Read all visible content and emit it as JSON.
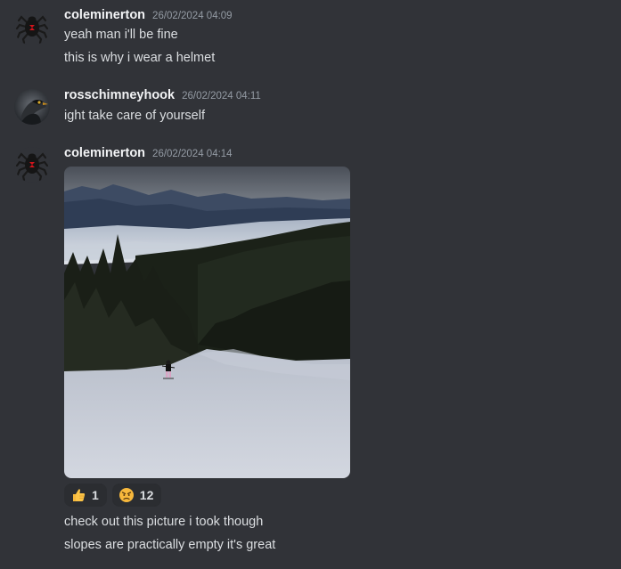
{
  "messages": [
    {
      "author": "coleminerton",
      "timestamp": "26/02/2024 04:09",
      "lines": [
        "yeah man i'll be fine",
        "this is why i wear a helmet"
      ]
    },
    {
      "author": "rosschimneyhook",
      "timestamp": "26/02/2024 04:11",
      "lines": [
        "ight take care of yourself"
      ]
    },
    {
      "author": "coleminerton",
      "timestamp": "26/02/2024 04:14",
      "lines": [
        "check out this picture i took though",
        "slopes are practically empty it's great"
      ],
      "reactions": [
        {
          "emoji": "thumbs-up",
          "count": "1"
        },
        {
          "emoji": "angry-face",
          "count": "12"
        }
      ]
    }
  ],
  "colors": {
    "background": "#313338",
    "username": "#f2f3f5",
    "text": "#dbdee1",
    "timestamp": "#949ba4",
    "reaction_bg": "#2b2d31"
  }
}
